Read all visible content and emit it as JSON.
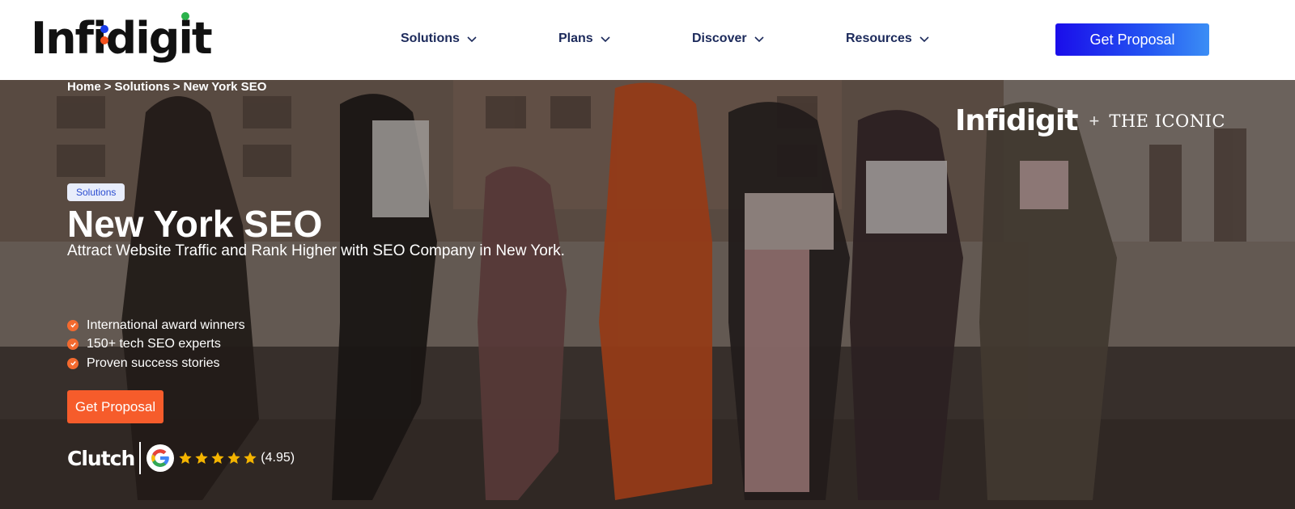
{
  "header": {
    "logo": "Infidigit",
    "nav": [
      {
        "label": "Solutions"
      },
      {
        "label": "Plans"
      },
      {
        "label": "Discover"
      },
      {
        "label": "Resources"
      }
    ],
    "cta_label": "Get Proposal"
  },
  "hero": {
    "breadcrumb": [
      "Home",
      ">",
      "Solutions",
      ">",
      "New York SEO"
    ],
    "partner": {
      "logo": "Infidigit",
      "plus": "+",
      "brand": "THE ICONIC"
    },
    "tag": "Solutions",
    "title": "New York SEO",
    "subtitle": "Attract Website Traffic and Rank Higher with SEO Company in New York.",
    "features": [
      "International award winners",
      "150+ tech SEO experts",
      "Proven success stories"
    ],
    "cta_label": "Get Proposal",
    "rating": {
      "clutch_label": "Clutch",
      "stars": 5,
      "score": "(4.95)"
    }
  },
  "colors": {
    "header_cta_gradient": [
      "#1a0dea",
      "#3b8ef5"
    ],
    "hero_cta": "#f65c2b",
    "check": "#f36a2f",
    "nav_text": "#1c2a5b",
    "tag_bg": "#e8edfb",
    "star": "#f4b400"
  },
  "icons": [
    "chevron-down-icon",
    "check-circle-icon",
    "google-g-icon",
    "star-icon"
  ]
}
